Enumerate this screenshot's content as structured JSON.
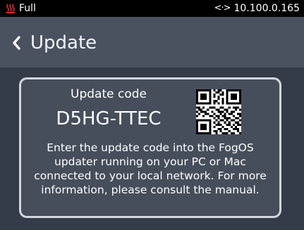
{
  "status_bar": {
    "heat_icon": "heating-coil-icon",
    "level": "Full",
    "network_icon": "network-arrows-icon",
    "network_glyph": "<·>",
    "ip_address": "10.100.0.165"
  },
  "header": {
    "back_icon": "chevron-left-icon",
    "title": "Update"
  },
  "card": {
    "code_label": "Update code",
    "code_value": "D5HG-TTEC",
    "qr_icon": "qr-code-icon",
    "instructions": "Enter the update code into the FogOS updater running on your PC or Mac connected to your local network. For more information, please consult the manual."
  },
  "colors": {
    "status_bar_bg": "#000000",
    "header_bg": "#4a5260",
    "page_bg": "#343c49",
    "card_bg": "#464e5b",
    "card_border": "#d2d6de",
    "heat_icon": "#e0262c"
  }
}
